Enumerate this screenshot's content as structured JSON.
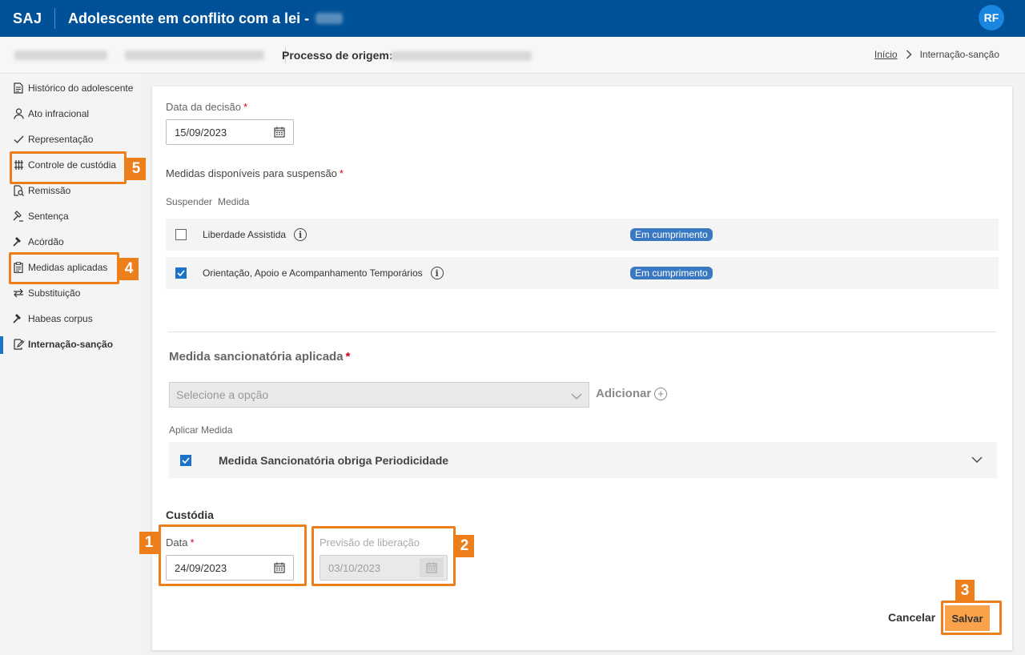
{
  "header": {
    "brand": "SAJ",
    "title": "Adolescente em conflito com a lei -",
    "user_initials": "RF"
  },
  "subheader": {
    "origin_label": "Processo de origem:",
    "breadcrumb": {
      "home": "Início",
      "current": "Internação-sanção"
    }
  },
  "sidebar": {
    "items": [
      {
        "label": "Histórico do adolescente",
        "icon": "document-icon"
      },
      {
        "label": "Ato infracional",
        "icon": "person-icon"
      },
      {
        "label": "Representação",
        "icon": "check-icon"
      },
      {
        "label": "Controle de custódia",
        "icon": "bars-icon"
      },
      {
        "label": "Remissão",
        "icon": "document-search-icon"
      },
      {
        "label": "Sentença",
        "icon": "gavel-icon"
      },
      {
        "label": "Acórdão",
        "icon": "gavel-icon"
      },
      {
        "label": "Medidas aplicadas",
        "icon": "clipboard-icon"
      },
      {
        "label": "Substituição",
        "icon": "swap-icon"
      },
      {
        "label": "Habeas corpus",
        "icon": "gavel-icon"
      },
      {
        "label": "Internação-sanção",
        "icon": "edit-icon",
        "active": true
      }
    ]
  },
  "form": {
    "decision_date_label": "Data da decisão",
    "decision_date_value": "15/09/2023",
    "available_label": "Medidas disponíveis para suspensão",
    "col_suspend": "Suspender",
    "col_measure": "Medida",
    "measures": [
      {
        "name": "Liberdade Assistida",
        "status": "Em cumprimento",
        "checked": false
      },
      {
        "name": "Orientação, Apoio e Acompanhamento Temporários",
        "status": "Em cumprimento",
        "checked": true
      }
    ],
    "sanction_title": "Medida sancionatória aplicada",
    "select_placeholder": "Selecione a opção",
    "add_label": "Adicionar",
    "apply_label": "Aplicar Medida",
    "applied_measure": "Medida Sancionatória obriga Periodicidade",
    "custody_title": "Custódia",
    "date_label": "Data",
    "date_value": "24/09/2023",
    "release_label": "Previsão de liberação",
    "release_value": "03/10/2023",
    "cancel_label": "Cancelar",
    "save_label": "Salvar",
    "required_mark": "*"
  },
  "annotations": [
    "1",
    "2",
    "3",
    "4",
    "5"
  ],
  "colors": {
    "header": "#005197",
    "accent": "#1a73c8",
    "badge": "#3a79c2",
    "highlight": "#ec7f1b",
    "save": "#f9a24a"
  }
}
